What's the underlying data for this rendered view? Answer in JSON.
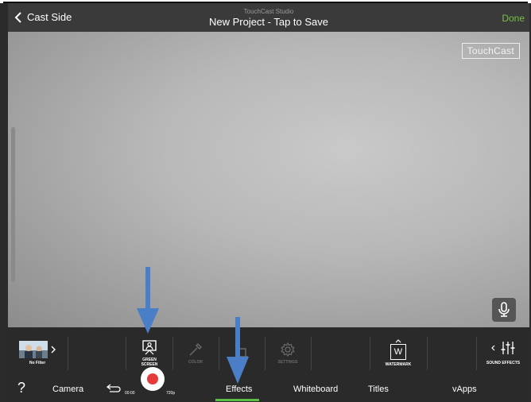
{
  "header": {
    "back_label": "Cast Side",
    "app_name": "TouchCast Studio",
    "project_title": "New Project - Tap to Save",
    "done_label": "Done"
  },
  "canvas": {
    "watermark_text": "TouchCast"
  },
  "effects_bar": {
    "filter_label": "No Filter",
    "green_screen_label_1": "GREEN",
    "green_screen_label_2": "SCREEN",
    "color_label": "COLOR",
    "settings_label": "SETTINGS",
    "watermark_label": "WATERMARK",
    "watermark_letter": "W",
    "sound_effects_label": "SOUND EFFECTS"
  },
  "bottom_nav": {
    "help": "?",
    "camera": "Camera",
    "time": "00:00",
    "resolution": "720p",
    "effects": "Effects",
    "whiteboard": "Whiteboard",
    "titles": "Titles",
    "vapps": "vApps",
    "active_tab": "Effects"
  },
  "colors": {
    "accent_green": "#5bbd45",
    "done_green": "#77c043",
    "record_red": "#e53b3b",
    "annotation_arrow": "#4a7fc8"
  },
  "icons": [
    "chevron-left-icon",
    "microphone-icon",
    "green-screen-icon",
    "eyedropper-icon",
    "crop-icon",
    "gear-icon",
    "watermark-icon",
    "sliders-icon",
    "undo-icon",
    "record-icon",
    "chevron-right-icon",
    "arrow-down-icon"
  ]
}
